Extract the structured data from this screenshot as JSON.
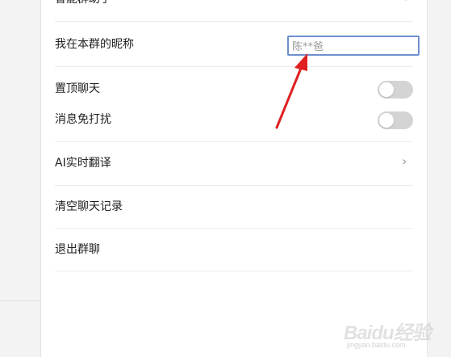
{
  "sidebar": {},
  "settings": {
    "top_partial_label": "智能群助手",
    "nickname": {
      "label": "我在本群的昵称",
      "value": "陈**爸"
    },
    "pin_chat": {
      "label": "置顶聊天",
      "enabled": false
    },
    "mute": {
      "label": "消息免打扰",
      "enabled": false
    },
    "ai_translate": {
      "label": "AI实时翻译"
    },
    "clear_history": {
      "label": "清空聊天记录"
    },
    "leave_group": {
      "label": "退出群聊"
    }
  },
  "annotation": {
    "arrow_color": "#e02020"
  },
  "watermark": {
    "text": "Baidu经验",
    "sub": "jingyan.baidu.com"
  },
  "icons": {
    "chevron": "chevron-right-icon"
  }
}
